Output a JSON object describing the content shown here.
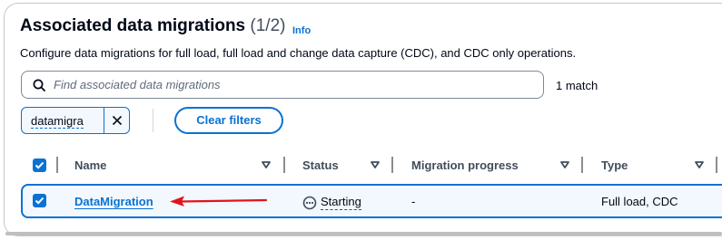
{
  "header": {
    "title": "Associated data migrations",
    "count": "(1/2)",
    "info_label": "Info",
    "description": "Configure data migrations for full load, full load and change data capture (CDC), and CDC only operations."
  },
  "search": {
    "placeholder": "Find associated data migrations",
    "value": "",
    "match_count": "1 match"
  },
  "filter_token": {
    "label": "datamigra"
  },
  "clear_filters_label": "Clear filters",
  "table": {
    "columns": [
      "Name",
      "Status",
      "Migration progress",
      "Type"
    ],
    "select_all_checked": true,
    "rows": [
      {
        "selected": true,
        "name": "DataMigration",
        "status": "Starting",
        "progress": "-",
        "type": "Full load, CDC"
      }
    ]
  },
  "annotation": {
    "arrow_color": "#e0141e"
  },
  "colors": {
    "accent": "#0972d3",
    "selected_row_bg": "#f2f8fd"
  }
}
